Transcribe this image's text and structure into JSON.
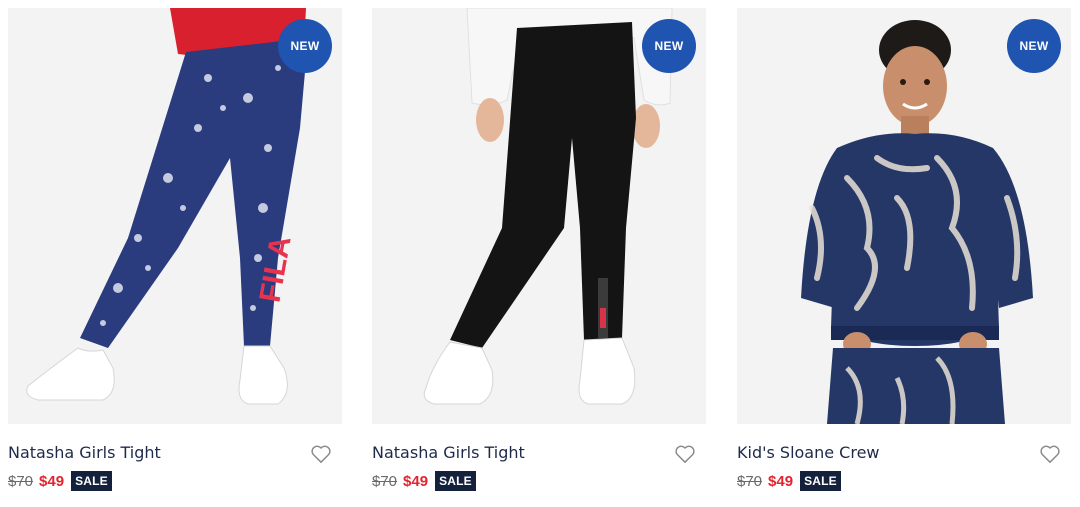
{
  "products": [
    {
      "name": "Natasha Girls Tight",
      "badge": "NEW",
      "original_price": "$70",
      "sale_price": "$49",
      "sale_tag": "SALE",
      "image_desc": "navy paisley leggings",
      "colors": {
        "garment": "#2a3b7e",
        "top": "#d8202e",
        "logo": "#e8334f"
      }
    },
    {
      "name": "Natasha Girls Tight",
      "badge": "NEW",
      "original_price": "$70",
      "sale_price": "$49",
      "sale_tag": "SALE",
      "image_desc": "black leggings",
      "colors": {
        "garment": "#141414",
        "top": "#f5f5f5",
        "logo": "#d7344b"
      }
    },
    {
      "name": "Kid's Sloane Crew",
      "badge": "NEW",
      "original_price": "$70",
      "sale_price": "$49",
      "sale_tag": "SALE",
      "image_desc": "boy in navy marble crewneck",
      "colors": {
        "garment": "#243766",
        "pattern": "#e9e1d6",
        "skin": "#c98f6c"
      }
    }
  ],
  "theme": {
    "badge_bg": "#1f54b0",
    "sale_price_color": "#e2242f",
    "sale_tag_bg": "#14213d",
    "heart_icon": "heart-outline-icon"
  }
}
